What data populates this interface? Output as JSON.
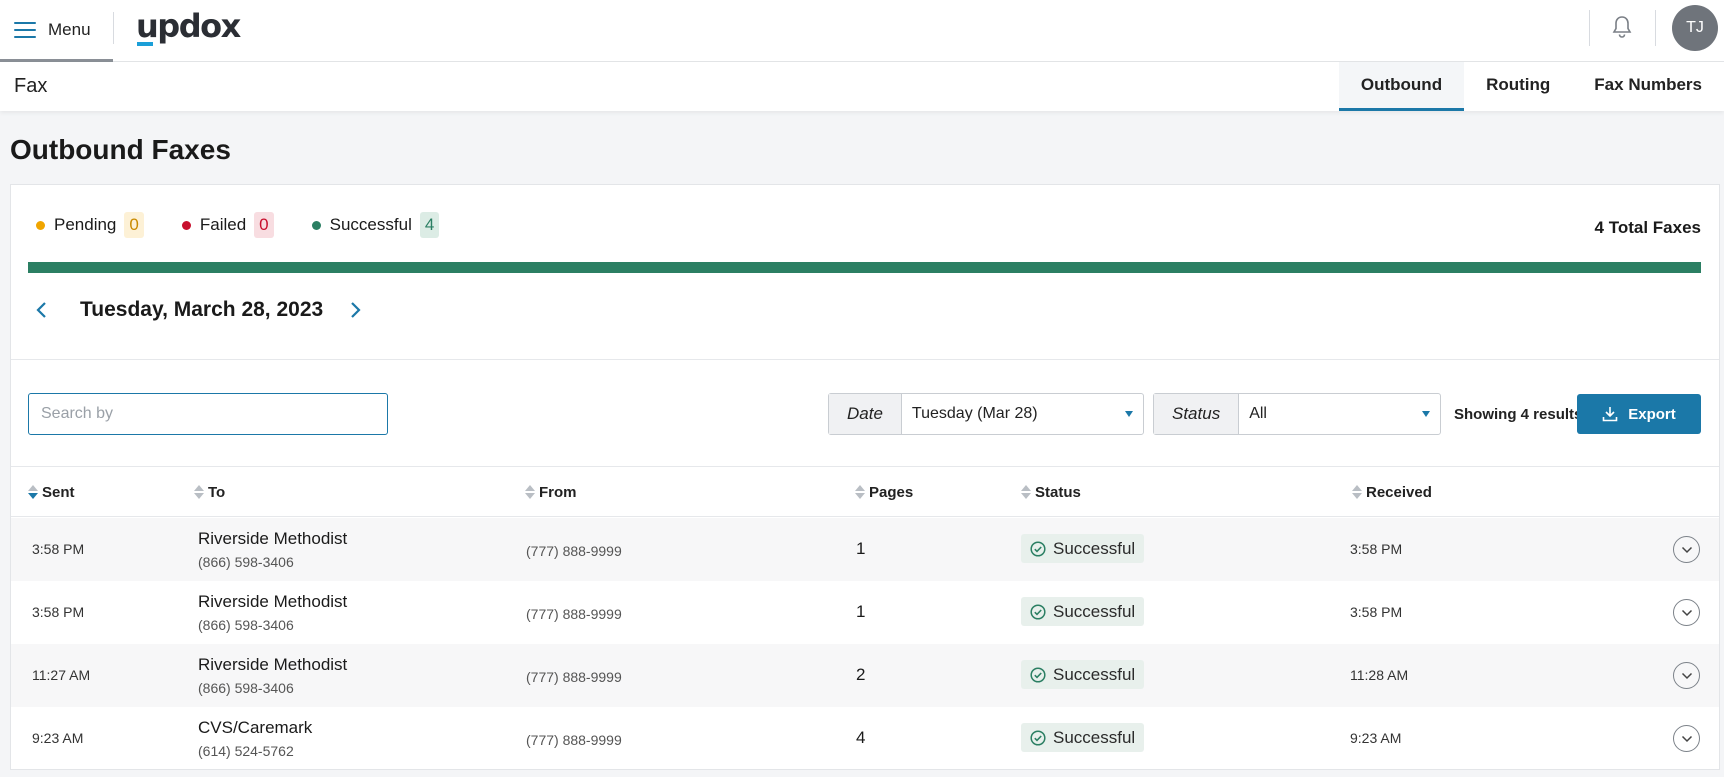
{
  "topbar": {
    "menu_label": "Menu",
    "logo_text": "updox",
    "avatar_initials": "TJ",
    "notifications_icon": "bell-icon"
  },
  "subnav": {
    "title": "Fax",
    "tabs": [
      {
        "label": "Outbound",
        "active": true
      },
      {
        "label": "Routing",
        "active": false
      },
      {
        "label": "Fax Numbers",
        "active": false
      }
    ]
  },
  "page_title": "Outbound Faxes",
  "summary": {
    "pending": {
      "label": "Pending",
      "count": "0",
      "color": "#f0a500"
    },
    "failed": {
      "label": "Failed",
      "count": "0",
      "color": "#c8102e"
    },
    "successful": {
      "label": "Successful",
      "count": "4",
      "color": "#2b7f63"
    },
    "total_label": "4 Total Faxes",
    "success_fraction": 1.0
  },
  "date_nav": {
    "current_date": "Tuesday, March 28, 2023"
  },
  "filters": {
    "search_placeholder": "Search by",
    "date_label": "Date",
    "date_value": "Tuesday (Mar 28)",
    "status_label": "Status",
    "status_value": "All",
    "showing": "Showing 4 results",
    "export_label": "Export"
  },
  "table": {
    "columns": [
      "Sent",
      "To",
      "From",
      "Pages",
      "Status",
      "Received"
    ],
    "rows": [
      {
        "sent": "3:58 PM",
        "to_name": "Riverside Methodist",
        "to_number": "(866) 598-3406",
        "from": "(777) 888-9999",
        "pages": "1",
        "status": "Successful",
        "received": "3:58 PM"
      },
      {
        "sent": "3:58 PM",
        "to_name": "Riverside Methodist",
        "to_number": "(866) 598-3406",
        "from": "(777) 888-9999",
        "pages": "1",
        "status": "Successful",
        "received": "3:58 PM"
      },
      {
        "sent": "11:27 AM",
        "to_name": "Riverside Methodist",
        "to_number": "(866) 598-3406",
        "from": "(777) 888-9999",
        "pages": "2",
        "status": "Successful",
        "received": "11:28 AM"
      },
      {
        "sent": "9:23 AM",
        "to_name": "CVS/Caremark",
        "to_number": "(614) 524-5762",
        "from": "(777) 888-9999",
        "pages": "4",
        "status": "Successful",
        "received": "9:23 AM"
      }
    ]
  },
  "colors": {
    "accent": "#1b78a8",
    "success": "#2b7f63"
  }
}
